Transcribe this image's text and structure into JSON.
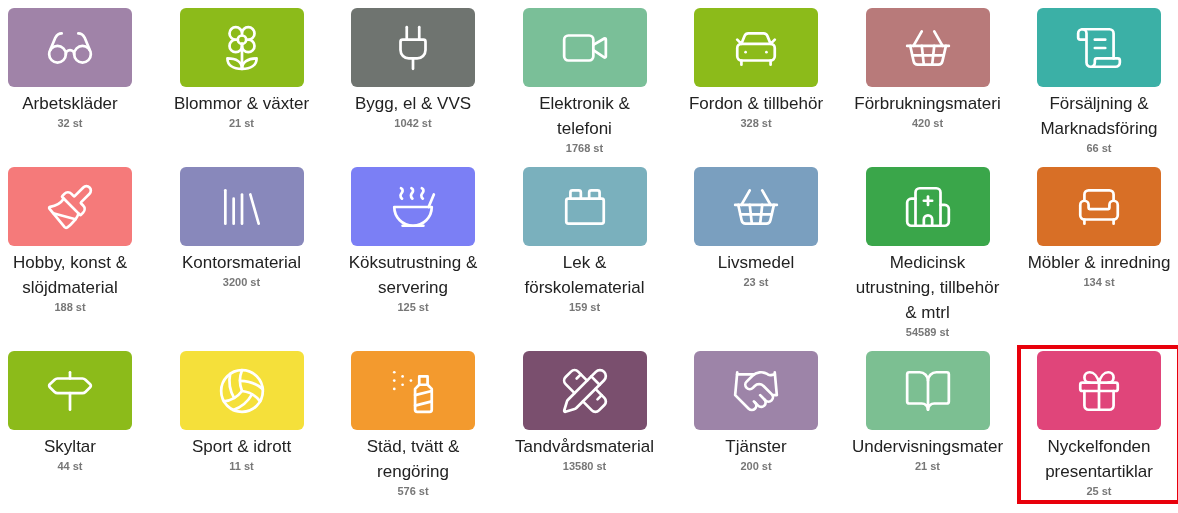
{
  "categories": [
    {
      "label": "Arbetskläder",
      "count": "32 st",
      "color": "#a083a8",
      "selected": false
    },
    {
      "label": "Blommor & växter",
      "count": "21 st",
      "color": "#8cbb1a",
      "selected": false
    },
    {
      "label": "Bygg, el & VVS",
      "count": "1042 st",
      "color": "#6f7470",
      "selected": false
    },
    {
      "label": "Elektronik & telefoni",
      "count": "1768 st",
      "color": "#7abf98",
      "selected": false
    },
    {
      "label": "Fordon & tillbehör",
      "count": "328 st",
      "color": "#8cbb1a",
      "selected": false
    },
    {
      "label": "Förbrukningsmateri",
      "count": "420 st",
      "color": "#b87a7a",
      "selected": false
    },
    {
      "label": "Försäljning & Marknadsföring",
      "count": "66 st",
      "color": "#3bb0a6",
      "selected": false
    },
    {
      "label": "Hobby, konst & slöjdmaterial",
      "count": "188 st",
      "color": "#f57a7a",
      "selected": false
    },
    {
      "label": "Kontorsmaterial",
      "count": "3200 st",
      "color": "#8888bb",
      "selected": false
    },
    {
      "label": "Köksutrustning & servering",
      "count": "125 st",
      "color": "#7b7ff5",
      "selected": false
    },
    {
      "label": "Lek & förskolematerial",
      "count": "159 st",
      "color": "#7ab0bd",
      "selected": false
    },
    {
      "label": "Livsmedel",
      "count": "23 st",
      "color": "#7a9fbf",
      "selected": false
    },
    {
      "label": "Medicinsk utrustning, tillbehör & mtrl",
      "count": "54589 st",
      "color": "#3aa64a",
      "selected": false
    },
    {
      "label": "Möbler & inredning",
      "count": "134 st",
      "color": "#d86f26",
      "selected": false
    },
    {
      "label": "Skyltar",
      "count": "44 st",
      "color": "#8cbb1a",
      "selected": false
    },
    {
      "label": "Sport & idrott",
      "count": "11 st",
      "color": "#f5e03a",
      "selected": false
    },
    {
      "label": "Städ, tvätt & rengöring",
      "count": "576 st",
      "color": "#f39a2e",
      "selected": false
    },
    {
      "label": "Tandvårdsmaterial",
      "count": "13580 st",
      "color": "#7a4f6e",
      "selected": false
    },
    {
      "label": "Tjänster",
      "count": "200 st",
      "color": "#9d84a8",
      "selected": false
    },
    {
      "label": "Undervisningsmater",
      "count": "21 st",
      "color": "#7cbf92",
      "selected": false
    },
    {
      "label": "Nyckelfonden presentartiklar",
      "count": "25 st",
      "color": "#e0457a",
      "selected": true
    }
  ]
}
